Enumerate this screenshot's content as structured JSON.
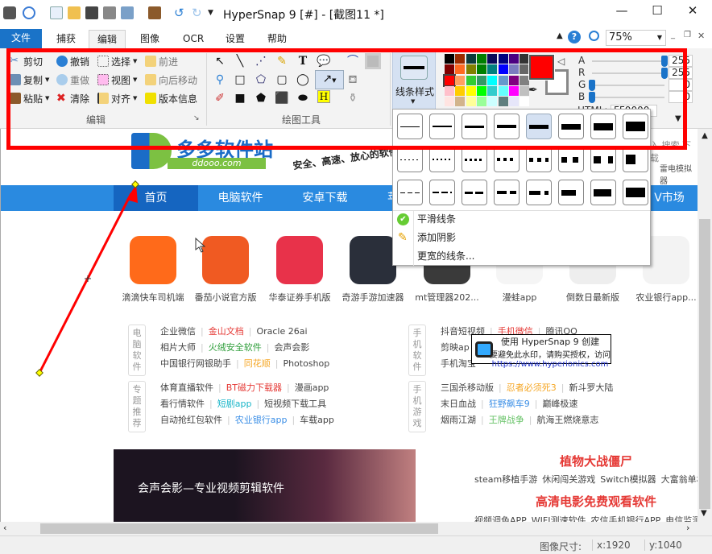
{
  "window": {
    "title": "HyperSnap 9 [#] - [截图11 *]",
    "minimize": "—",
    "maximize": "☐",
    "close": "✕"
  },
  "quick_access": [
    "camera-icon",
    "zoom-icon",
    "new-icon",
    "open-icon",
    "save-icon",
    "print-icon",
    "window-icon",
    "paste-icon",
    "undo-icon",
    "redo-icon",
    "customize-icon"
  ],
  "menu": {
    "tabs": [
      "文件",
      "捕获",
      "编辑",
      "图像",
      "OCR",
      "设置",
      "帮助"
    ],
    "active": "编辑",
    "zoom_value": "75%"
  },
  "ribbon": {
    "edit_group": {
      "label": "编辑",
      "buttons": [
        "剪切",
        "撤销",
        "选择",
        "前进",
        "复制",
        "重做",
        "视图",
        "向后移动",
        "粘贴",
        "清除",
        "对齐",
        "版本信息"
      ]
    },
    "draw_group": {
      "label": "绘图工具"
    },
    "line_style": {
      "label": "线条样式"
    },
    "palette": [
      "#000000",
      "#9c2b00",
      "#0d3b3b",
      "#007f00",
      "#0a0a5a",
      "#000080",
      "#4b0082",
      "#333333",
      "#800000",
      "#ff6a21",
      "#808000",
      "#008000",
      "#008080",
      "#0000ff",
      "#7b7bc0",
      "#666666",
      "#ff0000",
      "#ffa060",
      "#33cc33",
      "#339966",
      "#00ffff",
      "#6699cc",
      "#800080",
      "#808080",
      "#ffc0cb",
      "#ffcc00",
      "#ffff00",
      "#00ff00",
      "#33cccc",
      "#66ffff",
      "#ff00ff",
      "#c0c0c0",
      "#ffe4e1",
      "#d2b48c",
      "#ffff99",
      "#99ff99",
      "#ccffff",
      "#5f7f7f",
      "#e6e6fa",
      "#ffffff"
    ],
    "current_color": "#ff0000",
    "sliders": [
      {
        "label": "A",
        "value": "255"
      },
      {
        "label": "R",
        "value": "255"
      },
      {
        "label": "G",
        "value": "0"
      },
      {
        "label": "B",
        "value": "0"
      }
    ],
    "html_label": "HTML:",
    "html_value": "FF0000"
  },
  "popup": {
    "menu_items": [
      "平滑线条",
      "添加阴影",
      "更宽的线条..."
    ]
  },
  "web": {
    "logo_title": "多多软件站",
    "logo_sub": "ddooo.com",
    "slogan": "安全、高速、放心的软件",
    "search_text": "入 搜索 下载",
    "hot": "雷电模拟器",
    "nav": [
      "首页",
      "电脑软件",
      "安卓下载",
      "苹",
      "V市场"
    ],
    "apps": [
      "滴滴快车司机端",
      "番茄小说官方版",
      "华泰证券手机版",
      "奇游手游加速器",
      "mt管理器202...",
      "漫蛙app",
      "倒数日最新版",
      "农业银行app..."
    ],
    "cats": [
      {
        "name": "电脑软件",
        "rows": [
          [
            "企业微信",
            "金山文档",
            "Oracle 26ai"
          ],
          [
            "相片大师",
            "火绒安全软件",
            "会声会影"
          ],
          [
            "中国银行网银助手",
            "同花顺",
            "Photoshop"
          ]
        ]
      },
      {
        "name": "专题推荐",
        "rows": [
          [
            "体育直播软件",
            "BT磁力下载器",
            "漫画app"
          ],
          [
            "看行情软件",
            "短剧app",
            "短视频下载工具"
          ],
          [
            "自动抢红包软件",
            "农业银行app",
            "车载app"
          ]
        ]
      },
      {
        "name": "手机软件",
        "rows": [
          [
            "抖音短视频",
            "手机微信",
            "腾讯QQ"
          ],
          [
            "剪映ap"
          ],
          [
            "手机淘宝"
          ]
        ]
      },
      {
        "name": "手机游戏",
        "rows": [
          [
            "三国杀移动版",
            "忍者必须死3",
            "新斗罗大陆"
          ],
          [
            "末日血战",
            "狂野飙车9",
            "巅峰极速"
          ],
          [
            "烟雨江湖",
            "王牌战争",
            "航海王燃烧意志"
          ]
        ]
      }
    ],
    "banner_text": "会声会影—专业视频剪辑软件",
    "right_title1": "植物大战僵尸",
    "right_links1": [
      "steam移植手游",
      "休闲闯关游戏",
      "Switch模拟器",
      "大富翁单机"
    ],
    "right_title2": "高清电影免费观看软件",
    "right_links2": [
      "视频调色APP",
      "WIFI测速软件",
      "农信手机银行APP",
      "电信监测"
    ]
  },
  "watermark": {
    "line1": "使用 HyperSnap 9 创建",
    "line2": "要避免此水印，请购买授权，访问",
    "line3": "https://www.hyperionics.com"
  },
  "status": {
    "label": "图像尺寸:",
    "x": "x:1920",
    "y": "y:1040"
  }
}
